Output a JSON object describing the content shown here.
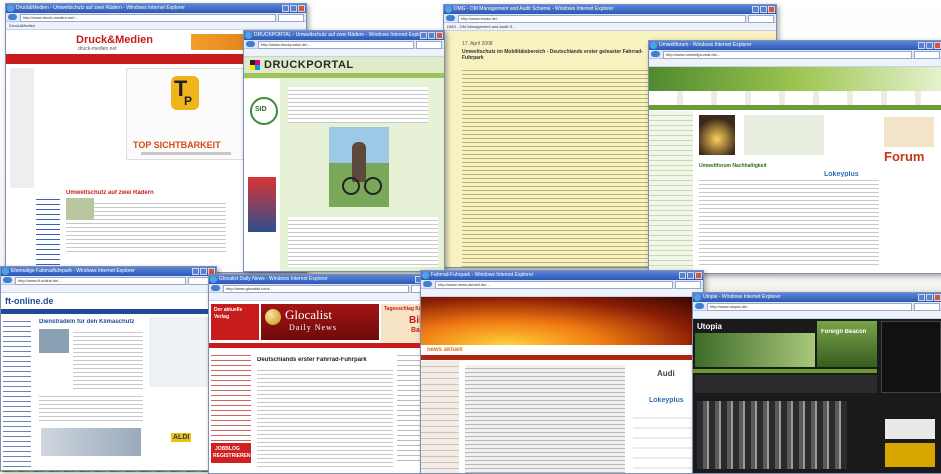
{
  "screens": [
    {
      "title": "Druck&Medien - Umweltschutz auf zwei Rädern - Windows Internet Explorer",
      "url": "http://www.druck-medien.net/...",
      "tab": "Druck&Medien",
      "logo": "Druck&Medien",
      "logo_sub": "druck-medien.net",
      "banner_headline": "TOP SICHTBARKEIT",
      "headline": "Umweltschutz auf zwei Rädern",
      "big_t": "T",
      "big_p": "P"
    },
    {
      "title": "DRUCKPORTAL - Umweltschutz auf zwei Rädern - Windows Internet Explorer",
      "url": "http://www.druckportal.de/...",
      "logo": "DRUCKPORTAL",
      "badge": "SID"
    },
    {
      "title": "DMG - DM Management and Audit Scheme - Windows Internet Explorer",
      "url": "http://www.emas.de/...",
      "tab": "DMG - DM Management and Audit S...",
      "date": "17. April 2008",
      "headline": "Umweltschutz im Mobilitätsbereich - Deutschlands erster geleaster Fahrrad-Fuhrpark"
    },
    {
      "title": "Umweltforum - Windows Internet Explorer",
      "url": "http://www.umweltjournal.de/...",
      "logo": "Forum",
      "partner": "Lokeyplus",
      "headline": "Umweltforum Nachhaltigkeit"
    },
    {
      "title": "Ehemalige Fahrradfuhrpark - Windows Internet Explorer",
      "url": "http://www.ft-online.de/...",
      "logo": "ft-online.de",
      "headline": "Dienstradeln für den Klimaschutz",
      "ad": "ALDI"
    },
    {
      "title": "Glocalist Daily News - Windows Internet Explorer",
      "url": "http://www.glocalist.com/...",
      "logo_main": "Glocalist",
      "logo_sub": "Daily News",
      "left_banner_line1": "Der aktuelle",
      "left_banner_line2": "Verlag",
      "right_banner_line1": "Tagesschlag für",
      "right_banner_word": "Bildu",
      "right_banner_sub": "Backh",
      "headline": "Deutschlands erster Fahrrad-Fuhrpark",
      "side_box_line1": "JOBBLOG",
      "side_box_line2": "REGISTRIEREN"
    },
    {
      "title": "Fahrrad-Fuhrpark - Windows Internet Explorer",
      "url": "http://www.news-aktuell.de/...",
      "brand": "news aktuell",
      "partner": "Lokeyplus",
      "ad": "Audi"
    },
    {
      "title": "Utopia - Windows Internet Explorer",
      "url": "http://www.utopia.de/...",
      "logo": "Utopia",
      "tagline": "Foreign Beacon"
    }
  ]
}
